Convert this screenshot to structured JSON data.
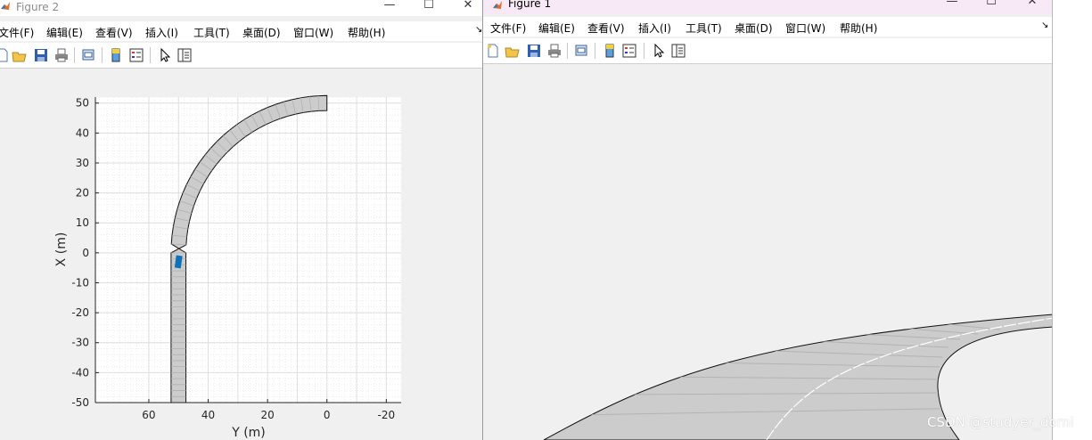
{
  "figure2": {
    "title": "Figure 2",
    "menu": [
      "文件(F)",
      "编辑(E)",
      "查看(V)",
      "插入(I)",
      "工具(T)",
      "桌面(D)",
      "窗口(W)",
      "帮助(H)"
    ],
    "plot": {
      "xlabel": "Y (m)",
      "ylabel": "X (m)",
      "x_ticks": [
        "60",
        "40",
        "20",
        "0",
        "-20"
      ],
      "y_ticks": [
        "50",
        "40",
        "30",
        "20",
        "10",
        "0",
        "-10",
        "-20",
        "-30",
        "-40",
        "-50"
      ],
      "road_color": "#cccccc",
      "vehicle_color": "#0e72b8"
    }
  },
  "figure1": {
    "title": "Figure 1",
    "menu": [
      "文件(F)",
      "编辑(E)",
      "查看(V)",
      "插入(I)",
      "工具(T)",
      "桌面(D)",
      "窗口(W)",
      "帮助(H)"
    ]
  },
  "chart_data": {
    "type": "scatter",
    "title": "",
    "xlabel": "Y (m)",
    "ylabel": "X (m)",
    "xlim": [
      78,
      -25
    ],
    "ylim": [
      -50,
      52
    ],
    "x_reversed": true,
    "grid": "on (major and minor)",
    "series": [
      {
        "points": [
          {
            "y_m": 50,
            "x_m": -50
          },
          {
            "y_m": 50,
            "x_m": 0
          },
          {
            "y_m": 45,
            "x_m": 20
          },
          {
            "y_m": 32,
            "x_m": 38
          },
          {
            "y_m": 15,
            "x_m": 47
          },
          {
            "y_m": 0,
            "x_m": 50
          }
        ]
      }
    ],
    "vehicle": {
      "y_m": 50,
      "x_m": -3
    }
  },
  "watermark": "CSDN @studyer_domi"
}
